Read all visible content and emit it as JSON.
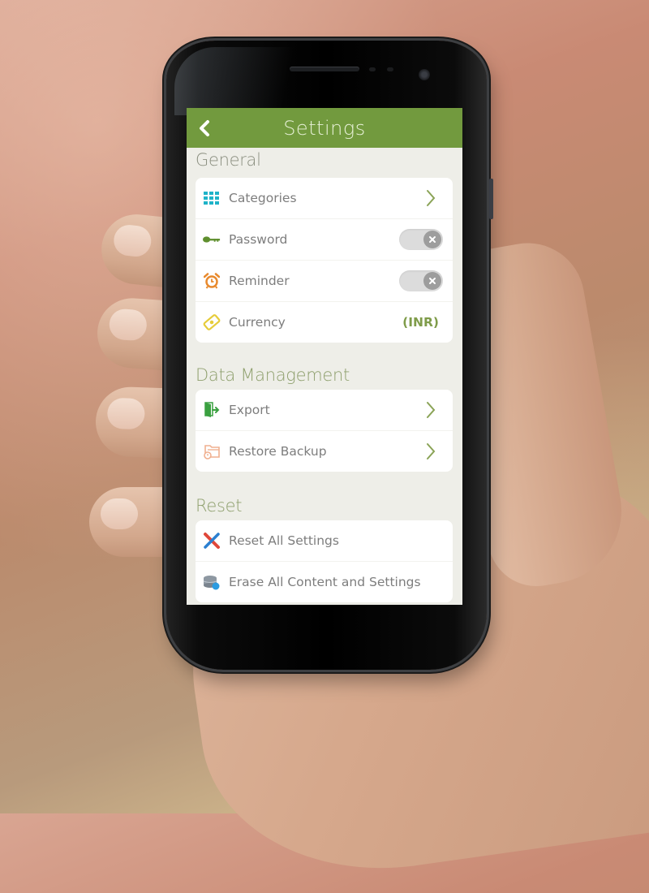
{
  "header": {
    "title": "Settings",
    "back_icon": "chevron-left-icon",
    "color": "#729a3e"
  },
  "sections": [
    {
      "title": "General",
      "items": [
        {
          "label": "Categories",
          "icon": "grid-icon",
          "icon_color": "#1fb3c8",
          "accessory": "chevron"
        },
        {
          "label": "Password",
          "icon": "key-icon",
          "icon_color": "#5f8f2e",
          "accessory": "toggle",
          "toggle_on": false
        },
        {
          "label": "Reminder",
          "icon": "alarm-clock-icon",
          "icon_color": "#e88a2e",
          "accessory": "toggle",
          "toggle_on": false
        },
        {
          "label": "Currency",
          "icon": "currency-note-icon",
          "icon_color": "#e6cc3a",
          "accessory": "value",
          "value": "(INR)"
        }
      ]
    },
    {
      "title": "Data Management",
      "items": [
        {
          "label": "Export",
          "icon": "export-door-icon",
          "icon_color": "#3aa040",
          "accessory": "chevron"
        },
        {
          "label": "Restore Backup",
          "icon": "folder-restore-icon",
          "icon_color": "#f0b090",
          "accessory": "chevron"
        }
      ]
    },
    {
      "title": "Reset",
      "items": [
        {
          "label": "Reset All Settings",
          "icon": "tools-cross-icon",
          "icon_color": "#e0483a",
          "accessory": "none"
        },
        {
          "label": "Erase All Content and Settings",
          "icon": "database-erase-icon",
          "icon_color": "#2b9be0",
          "accessory": "none"
        }
      ]
    }
  ],
  "colors": {
    "accent": "#729a3e",
    "chevron": "#8aa356",
    "value_text": "#7f9c4a",
    "screen_bg": "#eeeee8"
  }
}
